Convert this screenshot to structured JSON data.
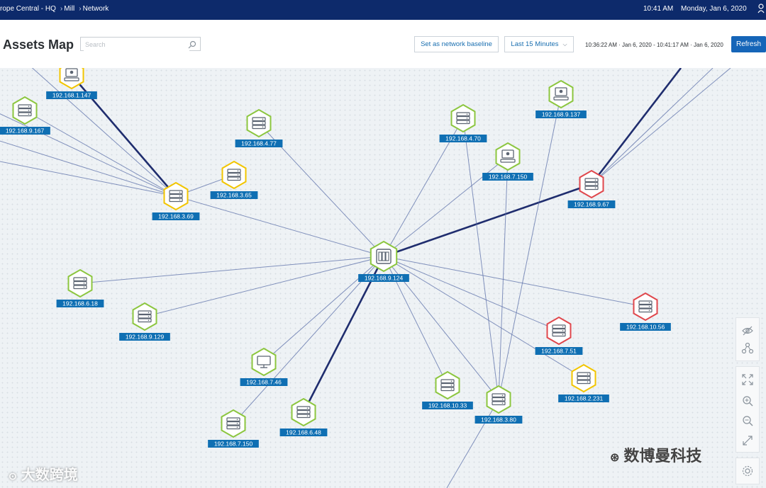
{
  "topbar": {
    "breadcrumb": [
      "rope Central - HQ",
      "Mill",
      "Network"
    ],
    "time": "10:41 AM",
    "date": "Monday, Jan 6, 2020"
  },
  "header": {
    "title": "Assets Map",
    "search_placeholder": "Search",
    "baseline_button": "Set as network baseline",
    "range_select": "Last 15 Minutes",
    "timespan": "10:36:22 AM · Jan 6, 2020 - 10:41:17 AM · Jan 6, 2020",
    "refresh_button": "Refresh"
  },
  "status_colors": {
    "ok": "#8cc63f",
    "warning": "#f2c500",
    "critical": "#e0474c"
  },
  "map": {
    "nodes": [
      {
        "id": "n1",
        "label": "192.168.1.147",
        "type": "workstation",
        "status": "warning"
      },
      {
        "id": "n2",
        "label": "192.168.9.167",
        "type": "server",
        "status": "ok"
      },
      {
        "id": "n3",
        "label": "192.168.4.77",
        "type": "server",
        "status": "ok"
      },
      {
        "id": "n4",
        "label": "192.168.3.65",
        "type": "server",
        "status": "warning"
      },
      {
        "id": "n5",
        "label": "192.168.3.69",
        "type": "server",
        "status": "warning"
      },
      {
        "id": "n6",
        "label": "192.168.4.70",
        "type": "server",
        "status": "ok"
      },
      {
        "id": "n7",
        "label": "192.168.9.137",
        "type": "workstation",
        "status": "ok"
      },
      {
        "id": "n8",
        "label": "192.168.7.150",
        "type": "workstation",
        "status": "ok"
      },
      {
        "id": "n9",
        "label": "192.168.9.67",
        "type": "server",
        "status": "critical"
      },
      {
        "id": "n10",
        "label": "192.168.9.124",
        "type": "switch",
        "status": "ok"
      },
      {
        "id": "n11",
        "label": "192.168.6.18",
        "type": "server",
        "status": "ok"
      },
      {
        "id": "n12",
        "label": "192.168.9.129",
        "type": "server",
        "status": "ok"
      },
      {
        "id": "n13",
        "label": "192.168.10.56",
        "type": "server",
        "status": "critical"
      },
      {
        "id": "n14",
        "label": "192.168.7.51",
        "type": "server",
        "status": "critical"
      },
      {
        "id": "n15",
        "label": "192.168.7.46",
        "type": "monitor",
        "status": "ok"
      },
      {
        "id": "n16",
        "label": "192.168.10.33",
        "type": "server",
        "status": "ok"
      },
      {
        "id": "n17",
        "label": "192.168.2.231",
        "type": "server",
        "status": "warning"
      },
      {
        "id": "n18",
        "label": "192.168.6.48",
        "type": "server",
        "status": "ok"
      },
      {
        "id": "n19",
        "label": "192.168.3.80",
        "type": "server",
        "status": "ok"
      },
      {
        "id": "n20",
        "label": "192.168.7.150",
        "type": "server",
        "status": "ok"
      }
    ]
  },
  "tools": {
    "hide": "eye-slash-icon",
    "topology": "topology-icon",
    "fit": "fit-screen-icon",
    "zoom_in": "zoom-in-icon",
    "zoom_out": "zoom-out-icon",
    "expand": "expand-icon",
    "settings": "gear-icon"
  },
  "watermarks": {
    "left": "大数跨境",
    "right": "数博曼科技"
  }
}
